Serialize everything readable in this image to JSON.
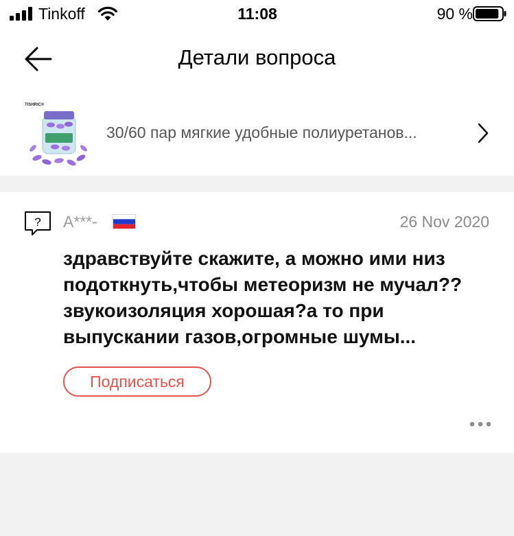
{
  "status_bar": {
    "carrier": "Tinkoff",
    "time": "11:08",
    "battery_percent": "90 %",
    "battery_level": 0.9,
    "signal_icon": "cellular-signal-icon",
    "wifi_icon": "wifi-icon",
    "battery_icon": "battery-icon"
  },
  "nav": {
    "title": "Детали вопроса",
    "back_icon": "arrow-left-icon"
  },
  "product": {
    "name": "30/60 пар мягкие удобные полиуретанов...",
    "thumbnail_brand": "TISHRIC®",
    "chevron_icon": "chevron-right-icon"
  },
  "question": {
    "icon": "question-bubble-icon",
    "author": "A***-",
    "flag_icon": "russia-flag-icon",
    "date": "26 Nov 2020",
    "text": "здравствуйте скажите, а можно ими низ\nподоткнуть,чтобы метеоризм не мучал??\nзвукоизоляция хорошая?а то при\nвыпускании газов,огромные шумы...",
    "subscribe_label": "Подписаться",
    "more_icon": "more-dots-icon"
  },
  "colors": {
    "accent": "#e8514a",
    "page_background": "#f2f2f2",
    "card_background": "#ffffff",
    "muted_text": "#9a9a9a"
  }
}
